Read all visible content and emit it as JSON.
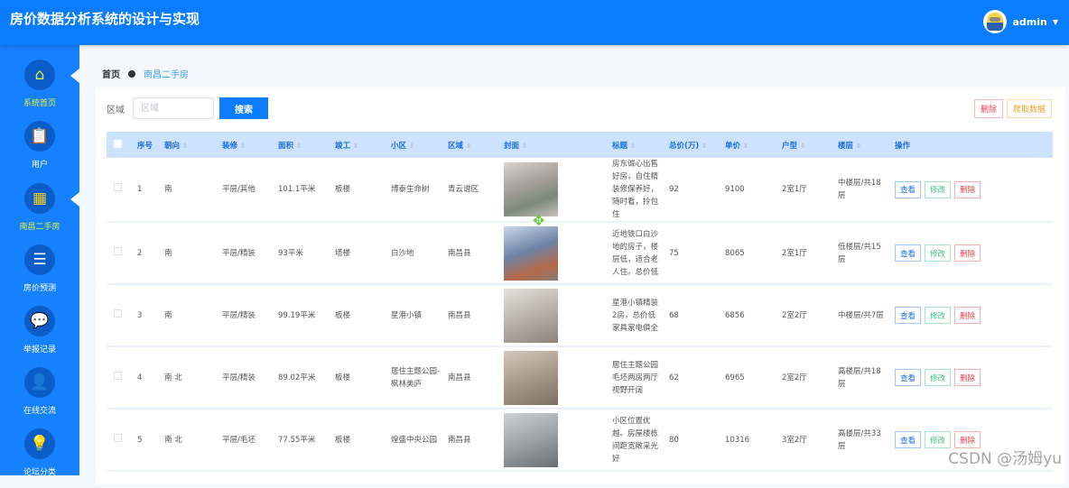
{
  "header": {
    "title": "房价数据分析系统的设计与实现",
    "user": "admin"
  },
  "sidebar": {
    "items": [
      {
        "label": "系统首页",
        "icon": "home-icon"
      },
      {
        "label": "用户",
        "icon": "clipboard-icon"
      },
      {
        "label": "南昌二手房",
        "icon": "grid-icon"
      },
      {
        "label": "房价预测",
        "icon": "list-icon"
      },
      {
        "label": "举报记录",
        "icon": "chat-icon"
      },
      {
        "label": "在线交流",
        "icon": "person-icon"
      },
      {
        "label": "论坛分类",
        "icon": "bulb-icon"
      }
    ]
  },
  "breadcrumb": {
    "home": "首页",
    "current": "南昌二手房"
  },
  "search": {
    "label": "区域",
    "placeholder": "区域",
    "button": "搜索"
  },
  "toolbar": {
    "delete": "删除",
    "crawl": "爬取数据"
  },
  "table": {
    "columns": [
      "序号",
      "朝向",
      "装修",
      "面积",
      "竣工",
      "小区",
      "区域",
      "封面",
      "标题",
      "总价(万)",
      "单价",
      "户型",
      "楼层",
      "操作"
    ],
    "actions": {
      "view": "查看",
      "edit": "修改",
      "delete": "删除"
    },
    "rows": [
      {
        "no": "1",
        "dir": "南",
        "deco": "平层/其他",
        "area": "101.1平米",
        "build": "板楼",
        "community": "博泰生命树",
        "district": "青云谱区",
        "title": "房东诚心出售好房，自住精装修保养好，随时看，拎包住",
        "total": "92",
        "unit": "9100",
        "layout": "2室1厅",
        "floor": "中楼层/共18层"
      },
      {
        "no": "2",
        "dir": "南",
        "deco": "平层/精装",
        "area": "93平米",
        "build": "塔楼",
        "community": "白沙地",
        "district": "南昌县",
        "title": "近地铁口白沙地的房子，楼层低，适合老人住。总价低",
        "total": "75",
        "unit": "8065",
        "layout": "2室1厅",
        "floor": "低楼层/共15层"
      },
      {
        "no": "3",
        "dir": "南",
        "deco": "平层/精装",
        "area": "99.19平米",
        "build": "板楼",
        "community": "星港小镇",
        "district": "南昌县",
        "title": "星港小镇精装2房，总价低家具家电俱全",
        "total": "68",
        "unit": "6856",
        "layout": "2室2厅",
        "floor": "中楼层/共7层"
      },
      {
        "no": "4",
        "dir": "南 北",
        "deco": "平层/精装",
        "area": "89.02平米",
        "build": "板楼",
        "community": "居住主题公园-枫林美庐",
        "district": "南昌县",
        "title": "居住主题公园毛坯两房两厅 视野开阔",
        "total": "62",
        "unit": "6965",
        "layout": "2室2厅",
        "floor": "高楼层/共18层"
      },
      {
        "no": "5",
        "dir": "南 北",
        "deco": "平层/毛坯",
        "area": "77.55平米",
        "build": "板楼",
        "community": "煌盛中央公园",
        "district": "南昌县",
        "title": "小区位置优越。房屋楼栋间距宽敞采光好",
        "total": "80",
        "unit": "10316",
        "layout": "3室2厅",
        "floor": "高楼层/共33层"
      }
    ]
  },
  "watermark": "CSDN @汤姆yu"
}
